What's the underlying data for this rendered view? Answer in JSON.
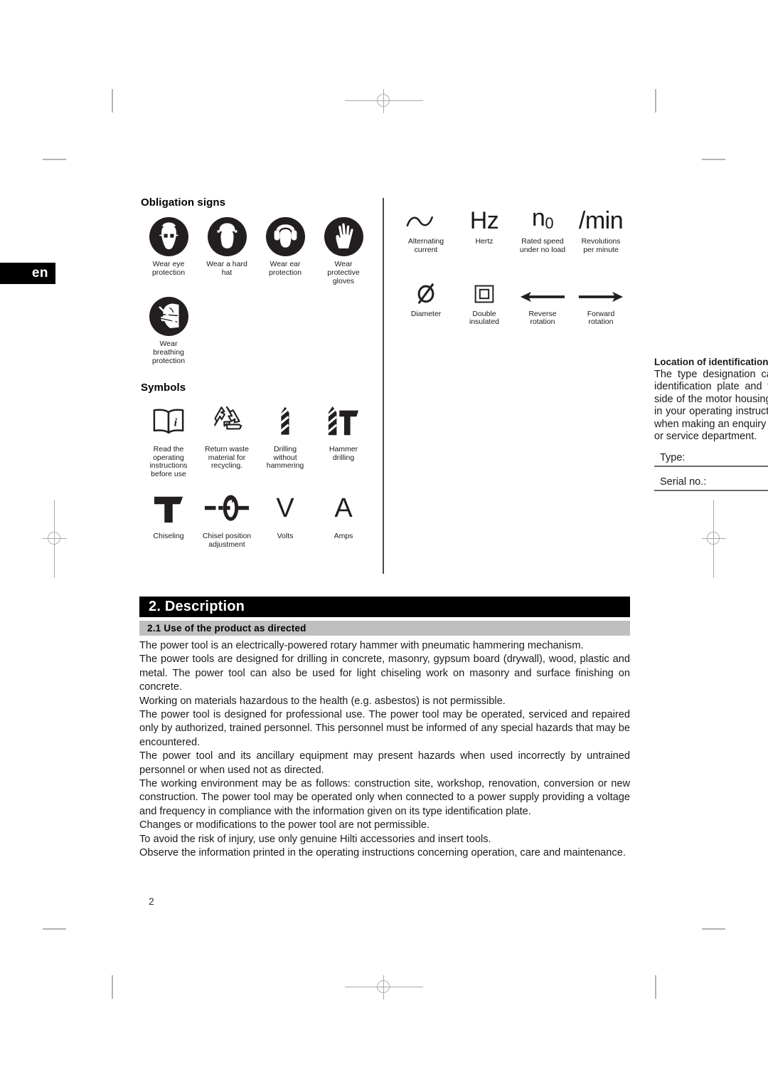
{
  "language_tab": "en",
  "page_number": "2",
  "obligation": {
    "title": "Obligation signs",
    "items": [
      {
        "icon": "wear-eye-protection-icon",
        "caption": "Wear eye\nprotection"
      },
      {
        "icon": "wear-hard-hat-icon",
        "caption": "Wear a hard\nhat"
      },
      {
        "icon": "wear-ear-protection-icon",
        "caption": "Wear ear\nprotection"
      },
      {
        "icon": "wear-protective-gloves-icon",
        "caption": "Wear\nprotective\ngloves"
      },
      {
        "icon": "wear-breathing-protection-icon",
        "caption": "Wear\nbreathing\nprotection"
      }
    ]
  },
  "symbols": {
    "title": "Symbols",
    "items": [
      {
        "icon": "read-operating-instructions-icon",
        "caption": "Read the\noperating\ninstructions\nbefore use"
      },
      {
        "icon": "recycling-icon",
        "caption": "Return waste\nmaterial for\nrecycling."
      },
      {
        "icon": "drilling-without-hammering-icon",
        "caption": "Drilling\nwithout\nhammering"
      },
      {
        "icon": "hammer-drilling-icon",
        "caption": "Hammer\ndrilling"
      },
      {
        "icon": "chiseling-icon",
        "caption": "Chiseling"
      },
      {
        "icon": "chisel-position-adjustment-icon",
        "caption": "Chisel position\nadjustment"
      },
      {
        "icon": "volts-icon",
        "caption": "Volts",
        "glyph": "V"
      },
      {
        "icon": "amps-icon",
        "caption": "Amps",
        "glyph": "A"
      }
    ]
  },
  "electrical": {
    "row1": [
      {
        "icon": "alternating-current-icon",
        "glyph": "",
        "caption": "Alternating\ncurrent"
      },
      {
        "icon": "hertz-icon",
        "glyph": "Hz",
        "caption": "Hertz"
      },
      {
        "icon": "rated-speed-icon",
        "glyph": "n0",
        "caption": "Rated speed\nunder no load"
      },
      {
        "icon": "revolutions-per-minute-icon",
        "glyph": "/min",
        "caption": "Revolutions\nper minute"
      }
    ],
    "row2": [
      {
        "icon": "diameter-icon",
        "glyph": "Ø",
        "caption": "Diameter"
      },
      {
        "icon": "double-insulated-icon",
        "glyph": "",
        "caption": "Double\ninsulated"
      },
      {
        "icon": "reverse-rotation-icon",
        "glyph": "",
        "caption": "Reverse\nrotation"
      },
      {
        "icon": "forward-rotation-icon",
        "glyph": "",
        "caption": "Forward\nrotation"
      }
    ]
  },
  "identification": {
    "heading": "Location of identification data on the power tool",
    "body": "The type designation can be found on the type identification plate and the serial number on the side of the motor housing. Make a note of this data in your operating instructions and always refer to it when making an enquiry to your Hilti representative or service department.",
    "type_label": "Type:",
    "serial_label": "Serial no.:"
  },
  "section": {
    "heading": "2. Description",
    "subheading": "2.1 Use of the product as directed",
    "paragraphs": [
      "The power tool is an electrically-powered rotary hammer with pneumatic hammering mechanism.",
      "The power tools are designed for drilling in concrete, masonry, gypsum board (drywall), wood, plastic and metal. The power tool can also be used for light chiseling work on masonry and surface finishing on concrete.",
      "Working on materials hazardous to the health (e.g. asbestos) is not permissible.",
      "The power tool is designed for professional use. The power tool may be operated, serviced and repaired only by authorized, trained personnel. This personnel must be informed of any special hazards that may be encountered.",
      "The power tool and its ancillary equipment may present hazards when used incorrectly by untrained personnel or when used not as directed.",
      "The working environment may be as follows: construction site, workshop, renovation, conversion or new construction. The power tool may be operated only when connected to a power supply providing a voltage and frequency in compliance with the information given on its type identification plate.",
      "Changes or modifications to the power tool are not permissible.",
      "To avoid the risk of injury, use only genuine Hilti accessories and insert tools.",
      "Observe the information printed in the operating instructions concerning operation, care and maintenance."
    ]
  },
  "colors": {
    "ink": "#1a1a1a",
    "heading_bar": "#000000",
    "sub_bar": "#bfbfbf",
    "crop_mark": "#b3b3b3"
  }
}
